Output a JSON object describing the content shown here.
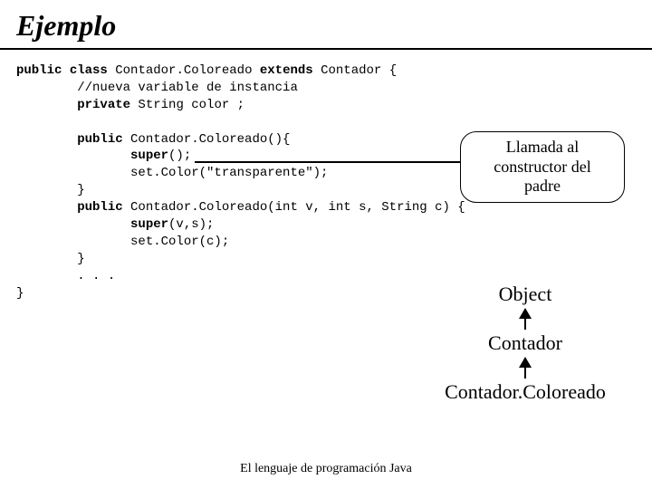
{
  "title": "Ejemplo",
  "code": {
    "l1a": "public",
    "l1b": " class",
    "l1c": " Contador.Coloreado ",
    "l1d": "extends",
    "l1e": " Contador {",
    "l2": "        //nueva variable de instancia",
    "l3a": "        private",
    "l3b": " String color ;",
    "l4": "",
    "l5a": "        public",
    "l5b": " Contador.Coloreado(){",
    "l6a": "               super",
    "l6b": "();",
    "l7": "               set.Color(\"transparente\");",
    "l8": "        }",
    "l9a": "        public",
    "l9b": " Contador.Coloreado(int v, int s, String c) {",
    "l10a": "               super",
    "l10b": "(v,s);",
    "l11": "               set.Color(c);",
    "l12": "        }",
    "l13": "        . . .",
    "l14": "}"
  },
  "callout": {
    "line1": "Llamada al",
    "line2": "constructor del",
    "line3": "padre"
  },
  "hierarchy": {
    "n1": "Object",
    "n2": "Contador",
    "n3": "Contador.Coloreado"
  },
  "footer": "El lenguaje de programación Java"
}
